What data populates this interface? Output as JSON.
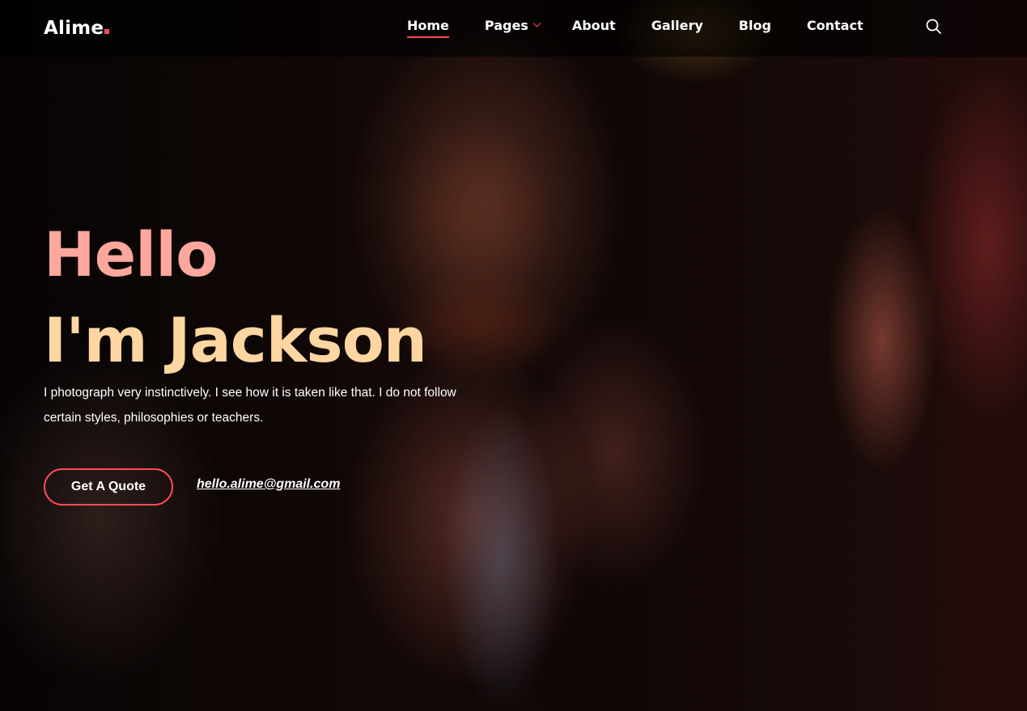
{
  "brand": {
    "name": "Alime",
    "dot_color": "#ff4b5c"
  },
  "nav": {
    "items": [
      {
        "label": "Home",
        "active": true
      },
      {
        "label": "Pages",
        "has_dropdown": true
      },
      {
        "label": "About"
      },
      {
        "label": "Gallery"
      },
      {
        "label": "Blog"
      },
      {
        "label": "Contact"
      }
    ],
    "search_icon": "search-icon"
  },
  "hero": {
    "title_line1": "Hello",
    "title_line2": "I'm Jackson",
    "description": "I photograph very instinctively. I see how it is taken like that. I do not follow certain styles, philosophies or teachers.",
    "cta_label": "Get A Quote",
    "email": "hello.alime@gmail.com"
  },
  "colors": {
    "accent": "#ff4b5c",
    "title_line1": "#ffa79c",
    "title_line2": "#ffd6a1"
  }
}
